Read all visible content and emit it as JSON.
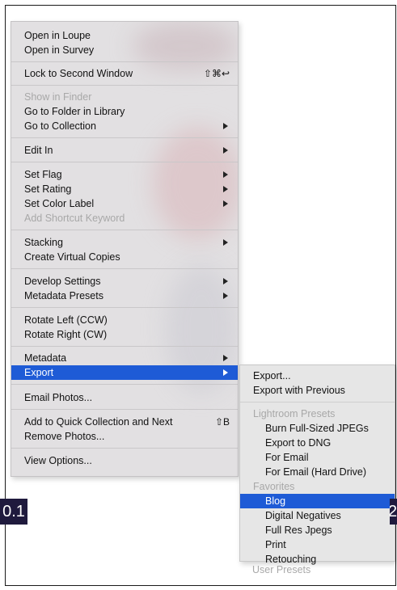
{
  "corner_labels": {
    "left": "0.1",
    "right": "2"
  },
  "context_menu": {
    "open_loupe": "Open in Loupe",
    "open_survey": "Open in Survey",
    "lock_window": "Lock to Second Window",
    "lock_window_shortcut": "⇧⌘↩",
    "show_finder": "Show in Finder",
    "go_folder": "Go to Folder in Library",
    "go_collection": "Go to Collection",
    "edit_in": "Edit In",
    "set_flag": "Set Flag",
    "set_rating": "Set Rating",
    "set_color_label": "Set Color Label",
    "add_shortcut_keyword": "Add Shortcut Keyword",
    "stacking": "Stacking",
    "create_virtual_copies": "Create Virtual Copies",
    "develop_settings": "Develop Settings",
    "metadata_presets": "Metadata Presets",
    "rotate_left": "Rotate Left (CCW)",
    "rotate_right": "Rotate Right (CW)",
    "metadata": "Metadata",
    "export": "Export",
    "email_photos": "Email Photos...",
    "add_quick_collection": "Add to Quick Collection and Next",
    "add_quick_collection_shortcut": "⇧B",
    "remove_photos": "Remove Photos...",
    "view_options": "View Options..."
  },
  "export_submenu": {
    "export": "Export...",
    "export_previous": "Export with Previous",
    "lightroom_presets_header": "Lightroom Presets",
    "burn_full_sized": "Burn Full-Sized JPEGs",
    "export_dng": "Export to DNG",
    "for_email": "For Email",
    "for_email_hd": "For Email (Hard Drive)",
    "favorites_header": "Favorites",
    "blog": "Blog",
    "digital_negatives": "Digital Negatives",
    "full_res_jpegs": "Full Res Jpegs",
    "print": "Print",
    "retouching": "Retouching",
    "user_presets_header": "User Presets"
  },
  "colors": {
    "selection": "#1e5bd6",
    "menu_bg": "#e2e0e2",
    "disabled_text": "#a8a8a8",
    "corner_label_bg": "#1f1a3d"
  }
}
